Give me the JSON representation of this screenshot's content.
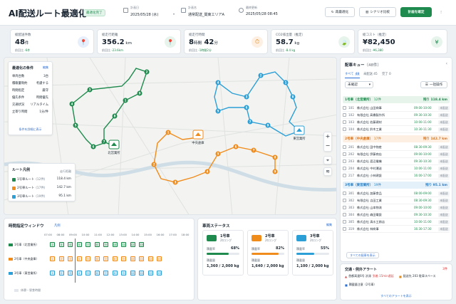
{
  "header": {
    "title": "AI配送ルート最適化",
    "badge": "最適化完了",
    "plan_date_label": "計画日",
    "plan_date_value": "2025/05/28 (水)",
    "plan_name_label": "計画名",
    "plan_name_value": "通常配送_関東エリアA",
    "last_update_label": "最終更新",
    "last_update_value": "2025/05/28 08:45",
    "btn_reoptimize": "再最適化",
    "btn_compare": "シナリオ比較",
    "btn_confirm": "計画を確定",
    "more": "⋮"
  },
  "kpis": [
    {
      "label": "総配送件数",
      "value": "48",
      "unit": "件",
      "sub_prefix": "前回比",
      "sub_delta": "-6件",
      "icon": "📍",
      "color": "#2b6fd6"
    },
    {
      "label": "総走行距離",
      "value": "356.2",
      "unit": " km",
      "sub_prefix": "前回比",
      "sub_delta": "-23.6km",
      "icon": "📍",
      "color": "#1f8a4d"
    },
    {
      "label": "総走行時間",
      "value": "8",
      "unit": "時間",
      "value2": "42",
      "unit2": "分",
      "sub_prefix": "前回比",
      "sub_delta": "-1時間2分",
      "icon": "⏱",
      "color": "#e08a1e"
    },
    {
      "label": "CO2排出量（推定）",
      "value": "58.7",
      "unit": " kg",
      "sub_prefix": "前回比",
      "sub_delta": "-8.4 kg",
      "icon": "🍃",
      "color": "#1f8a4d"
    },
    {
      "label": "総コスト（推定）",
      "value": "¥82,450",
      "unit": "",
      "sub_prefix": "前回比",
      "sub_delta": "-¥6,380",
      "icon": "¥",
      "color": "#1f8a4d"
    }
  ],
  "conditions": {
    "title": "最適化の条件",
    "edit": "編集",
    "rows": [
      {
        "k": "車両台数",
        "v": "3台"
      },
      {
        "k": "積載量制約",
        "v": "考慮する"
      },
      {
        "k": "時間指定",
        "v": "厳守"
      },
      {
        "k": "優先条件",
        "v": "時間優先"
      },
      {
        "k": "交通状況",
        "v": "リアルタイム"
      },
      {
        "k": "立寄り時間",
        "v": "1分/件"
      }
    ],
    "detail_link": "条件を詳細に表示"
  },
  "legend": {
    "title": "ルート凡例",
    "col": "走行距離",
    "routes": [
      {
        "name": "1号車ルート",
        "count": "(12件)",
        "dist": "118.4 km",
        "color": "#1f8a4d"
      },
      {
        "name": "2号車ルート",
        "count": "(17件)",
        "dist": "142.7 km",
        "color": "#f08c1c"
      },
      {
        "name": "3号車ルート",
        "count": "(19件)",
        "dist": "95.1 km",
        "color": "#2b9fd6"
      }
    ]
  },
  "map": {
    "depots": [
      {
        "name": "北営業所"
      },
      {
        "name": "中央倉庫"
      },
      {
        "name": "東営業所"
      }
    ],
    "green_stops": [
      "1",
      "2",
      "3",
      "4",
      "5",
      "6",
      "7",
      "8",
      "9"
    ],
    "orange_stops": [
      "1",
      "2",
      "3",
      "4",
      "5",
      "6",
      "7",
      "8",
      "9"
    ],
    "blue_stops": [
      "1",
      "2",
      "3",
      "4",
      "5",
      "6",
      "7",
      "8",
      "9"
    ]
  },
  "queue": {
    "title": "配車キュー",
    "count": "（48件）",
    "tabs": [
      {
        "label": "すべて",
        "n": "48"
      },
      {
        "label": "未配送",
        "n": "45"
      },
      {
        "label": "完了",
        "n": "0"
      }
    ],
    "filter": "未確認",
    "bulk": "一括操作",
    "groups": [
      {
        "title": "1号車（北営業所）",
        "count": "12件",
        "remain": "残り 118.4 km",
        "color": "#1f8a4d",
        "bg": "#e6f4ec",
        "items": [
          {
            "n": "101",
            "name": "株式会社 山田商事",
            "time": "09:00-10:00",
            "st": "未配送"
          },
          {
            "n": "102",
            "name": "有限会社 高橋製作所",
            "time": "09:30-10:30",
            "st": "未配送"
          },
          {
            "n": "103",
            "name": "株式会社 佐藤建材",
            "time": "10:00-11:00",
            "st": "未配送"
          },
          {
            "n": "104",
            "name": "株式会社 鈴木工業",
            "time": "10:30-11:30",
            "st": "未配送"
          }
        ]
      },
      {
        "title": "2号車（中央倉庫）",
        "count": "17件",
        "remain": "残り 142.7 km",
        "color": "#d9731a",
        "bg": "#fdf0e3",
        "items": [
          {
            "n": "201",
            "name": "株式会社 田中物産",
            "time": "08:30-09:30",
            "st": "未配送"
          },
          {
            "n": "202",
            "name": "有限会社 伊藤商店",
            "time": "09:00-10:00",
            "st": "未配送"
          },
          {
            "n": "203",
            "name": "株式会社 渡辺電機",
            "time": "09:30-10:30",
            "st": "未配送"
          },
          {
            "n": "204",
            "name": "株式会社 中村運送",
            "time": "10:00-11:00",
            "st": "未配送"
          },
          {
            "n": "217",
            "name": "株式会社 小林建設",
            "time": "16:00-17:00",
            "st": "未配送"
          }
        ]
      },
      {
        "title": "3号車（東営業所）",
        "count": "19件",
        "remain": "残り 95.1 km",
        "color": "#2b7fc4",
        "bg": "#e4f1fa",
        "items": [
          {
            "n": "301",
            "name": "株式会社 加藤食品",
            "time": "08:00-09:00",
            "st": "未配送"
          },
          {
            "n": "302",
            "name": "有限会社 吉田工業",
            "time": "08:30-09:30",
            "st": "未配送"
          },
          {
            "n": "303",
            "name": "株式会社 山本物流",
            "time": "09:00-10:00",
            "st": "未配送"
          },
          {
            "n": "304",
            "name": "株式会社 森田電設",
            "time": "09:30-10:30",
            "st": "未配送"
          },
          {
            "n": "305",
            "name": "株式会社 清水工務店",
            "time": "10:00-11:00",
            "st": "未配送"
          },
          {
            "n": "319",
            "name": "株式会社 林商事",
            "time": "16:30-17:30",
            "st": "未配送"
          }
        ]
      }
    ],
    "show_all": "すべての配車を表示"
  },
  "alerts": {
    "title": "交通・例外アラート",
    "count": "3件",
    "items": [
      {
        "text": "首都高速6号 渋滞",
        "sub": "到着 15min遅延"
      },
      {
        "text": "配送先 203 駐車スペース"
      },
      {
        "text": "積載量注意（2号車）"
      }
    ],
    "all": "すべてのアラートを表示"
  },
  "time_window": {
    "title": "時間指定ウィンドウ",
    "tag": "凡例",
    "hours": [
      "07:00",
      "08:00",
      "09:00",
      "10:00",
      "11:00",
      "12:00",
      "13:00",
      "14:00",
      "15:00",
      "16:00",
      "17:00",
      "18:00"
    ],
    "rows": [
      {
        "label": "1号車（北営業所）",
        "color": "#1f8a4d"
      },
      {
        "label": "2号車（中央倉庫）",
        "color": "#f08c1c"
      },
      {
        "label": "3号車（東営業所）",
        "color": "#2b9fd6"
      }
    ],
    "footer": "休憩・昼食時間"
  },
  "vehicles": {
    "title": "車両ステータス",
    "edit": "編集",
    "items": [
      {
        "name": "1号車",
        "type": "2tロング",
        "load_label": "積載率",
        "pct": "68%",
        "pct_val": 68,
        "weight_label": "積載量",
        "weight": "1,360 / 2,000 kg",
        "color": "#1f8a4d"
      },
      {
        "name": "2号車",
        "type": "2tロング",
        "load_label": "積載率",
        "pct": "82%",
        "pct_val": 82,
        "weight_label": "積載量",
        "weight": "1,640 / 2,000 kg",
        "color": "#f08c1c"
      },
      {
        "name": "3号車",
        "type": "2tロング",
        "load_label": "積載率",
        "pct": "55%",
        "pct_val": 55,
        "weight_label": "積載量",
        "weight": "1,100 / 2,000 kg",
        "color": "#2b9fd6"
      }
    ]
  }
}
